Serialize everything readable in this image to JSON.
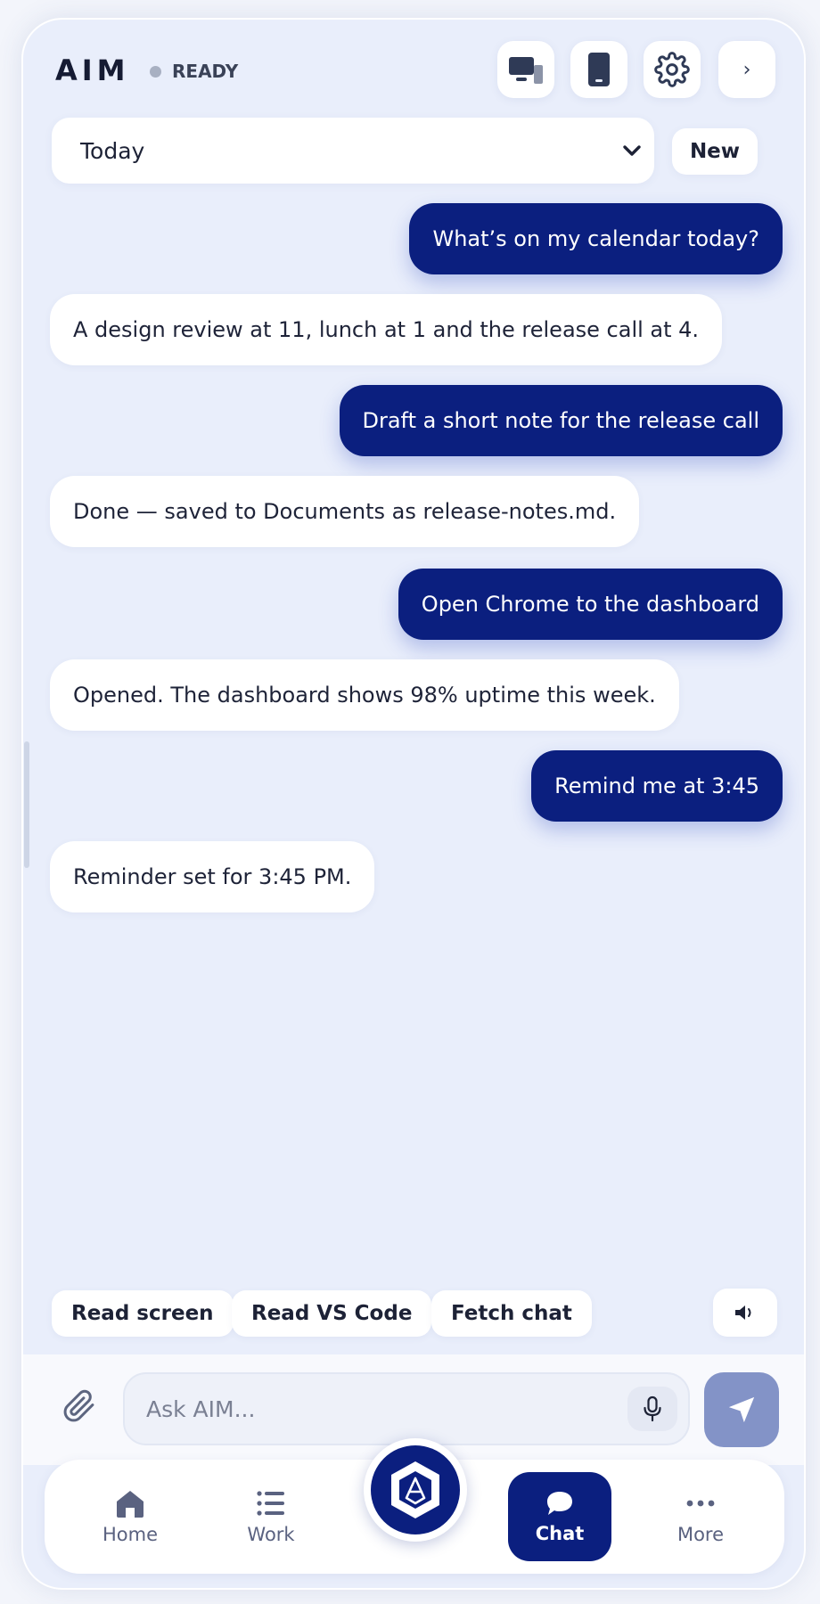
{
  "header": {
    "brand": "AIM",
    "status": "READY",
    "buttons": {
      "desktop_icon": "desktop-icon",
      "phone_icon": "phone-icon",
      "settings_icon": "gear-icon",
      "expand_label": "›"
    }
  },
  "session": {
    "selected": "Today",
    "new_label": "New"
  },
  "messages": [
    {
      "role": "user",
      "text": "What’s on my calendar today?"
    },
    {
      "role": "assistant",
      "text": "A design review at 11, lunch at 1 and the release call at 4."
    },
    {
      "role": "user",
      "text": "Draft a short note for the release call"
    },
    {
      "role": "assistant",
      "text": "Done — saved to Documents as release-notes.md."
    },
    {
      "role": "user",
      "text": "Open Chrome to the dashboard"
    },
    {
      "role": "assistant",
      "text": "Opened. The dashboard shows 98% uptime this week."
    },
    {
      "role": "user",
      "text": "Remind me at 3:45"
    },
    {
      "role": "assistant",
      "text": "Reminder set for 3:45 PM."
    }
  ],
  "quick_actions": [
    "Read screen",
    "Read VS Code",
    "Fetch chat"
  ],
  "composer": {
    "placeholder": "Ask AIM..."
  },
  "nav": {
    "items": [
      {
        "label": "Home",
        "icon": "home-icon"
      },
      {
        "label": "Work",
        "icon": "list-icon"
      },
      {
        "label": "Chat",
        "icon": "chat-bubble-icon",
        "active": true
      },
      {
        "label": "More",
        "icon": "more-dots-icon"
      }
    ]
  },
  "colors": {
    "accent": "#0b1f7f",
    "background": "#e9eefb",
    "send_disabled": "#8393c7"
  }
}
